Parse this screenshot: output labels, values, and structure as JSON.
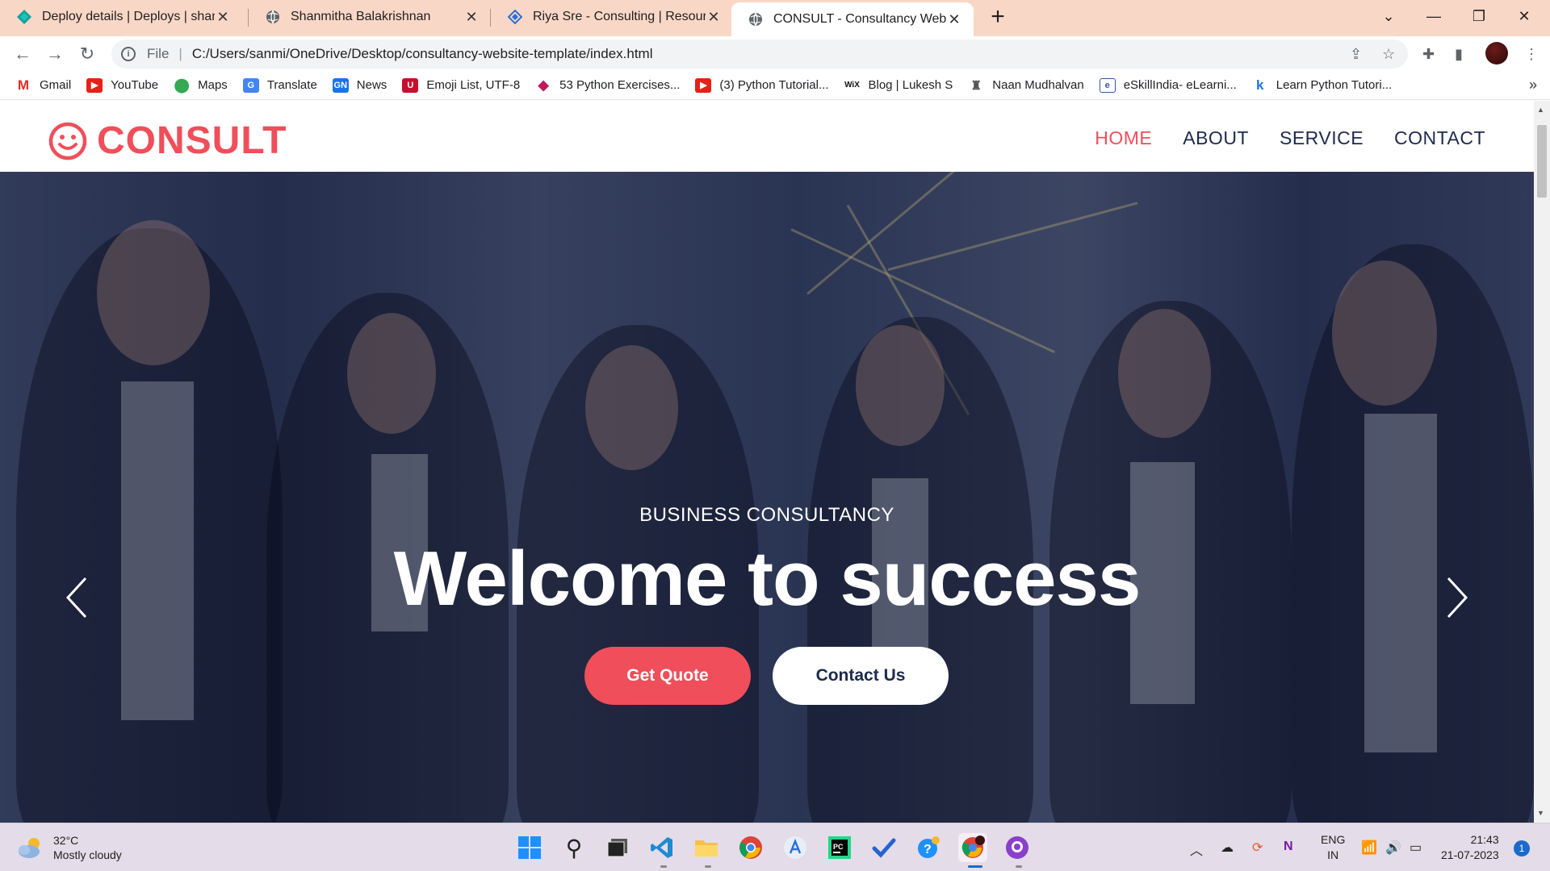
{
  "browser": {
    "tabs": [
      {
        "title": "Deploy details | Deploys | shanmi",
        "icon": "netlify-icon"
      },
      {
        "title": "Shanmitha Balakrishnan",
        "icon": "globe-icon"
      },
      {
        "title": "Riya Sre - Consulting | Resourcing",
        "icon": "diamond-icon"
      },
      {
        "title": "CONSULT - Consultancy Website",
        "icon": "globe-icon",
        "active": true
      }
    ],
    "address": {
      "scheme_label": "File",
      "url": "C:/Users/sanmi/OneDrive/Desktop/consultancy-website-template/index.html"
    },
    "bookmarks": [
      {
        "label": "Gmail",
        "icon": "gmail-icon"
      },
      {
        "label": "YouTube",
        "icon": "youtube-icon"
      },
      {
        "label": "Maps",
        "icon": "maps-icon"
      },
      {
        "label": "Translate",
        "icon": "translate-icon"
      },
      {
        "label": "News",
        "icon": "news-icon"
      },
      {
        "label": "Emoji List, UTF-8",
        "icon": "unicode-icon"
      },
      {
        "label": "53 Python Exercises...",
        "icon": "gem-icon"
      },
      {
        "label": "(3) Python Tutorial...",
        "icon": "youtube-icon"
      },
      {
        "label": "Blog | Lukesh S",
        "icon": "wix-icon"
      },
      {
        "label": "Naan Mudhalvan",
        "icon": "emblem-icon"
      },
      {
        "label": "eSkillIndia- eLearni...",
        "icon": "eskill-icon"
      },
      {
        "label": "Learn Python Tutori...",
        "icon": "k-icon"
      }
    ]
  },
  "site": {
    "brand": "CONSULT",
    "nav": [
      {
        "label": "HOME",
        "active": true
      },
      {
        "label": "ABOUT"
      },
      {
        "label": "SERVICE"
      },
      {
        "label": "CONTACT"
      }
    ],
    "hero": {
      "subtitle": "BUSINESS CONSULTANCY",
      "title": "Welcome to success",
      "primary_button": "Get Quote",
      "secondary_button": "Contact Us"
    },
    "colors": {
      "accent": "#f04e5a",
      "navy": "#1d2a4d"
    }
  },
  "taskbar": {
    "weather": {
      "temp": "32°C",
      "condition": "Mostly cloudy"
    },
    "language": {
      "lang": "ENG",
      "region": "IN"
    },
    "time": "21:43",
    "date": "21-07-2023",
    "notifications": "1"
  }
}
